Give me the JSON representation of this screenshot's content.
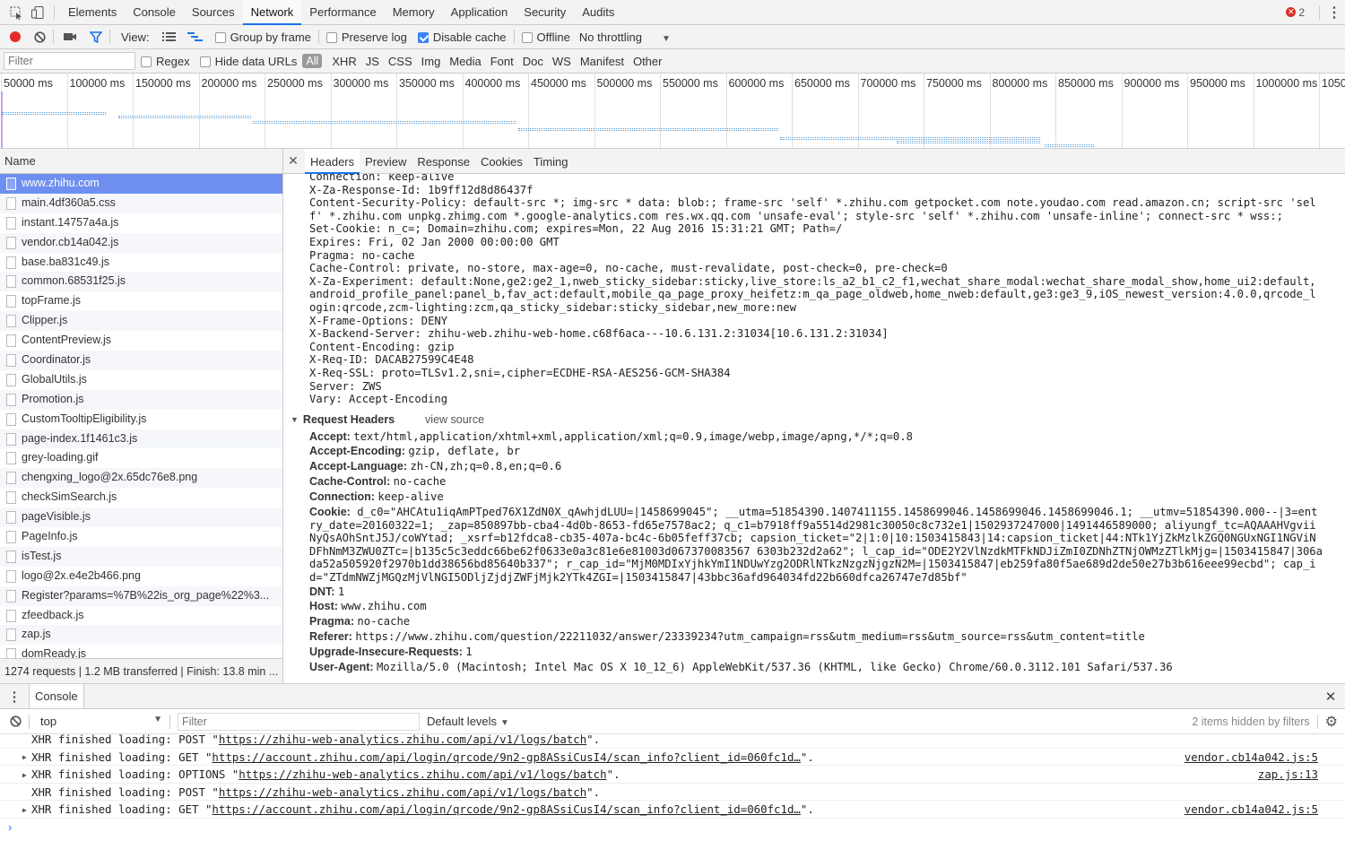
{
  "devtools": {
    "tabs": [
      "Elements",
      "Console",
      "Sources",
      "Network",
      "Performance",
      "Memory",
      "Application",
      "Security",
      "Audits"
    ],
    "active_tab": "Network",
    "error_count": "2"
  },
  "toolbar": {
    "view_label": "View:",
    "group_by_frame": "Group by frame",
    "preserve_log": "Preserve log",
    "disable_cache": "Disable cache",
    "offline": "Offline",
    "throttling": "No throttling"
  },
  "filterbar": {
    "placeholder": "Filter",
    "regex": "Regex",
    "hide_data_urls": "Hide data URLs",
    "types": [
      "All",
      "XHR",
      "JS",
      "CSS",
      "Img",
      "Media",
      "Font",
      "Doc",
      "WS",
      "Manifest",
      "Other"
    ]
  },
  "timeline": {
    "ticks": [
      "50000 ms",
      "100000 ms",
      "150000 ms",
      "200000 ms",
      "250000 ms",
      "300000 ms",
      "350000 ms",
      "400000 ms",
      "450000 ms",
      "500000 ms",
      "550000 ms",
      "600000 ms",
      "650000 ms",
      "700000 ms",
      "750000 ms",
      "800000 ms",
      "850000 ms",
      "900000 ms",
      "950000 ms",
      "1000000 ms",
      "1050"
    ]
  },
  "requests": {
    "column_name": "Name",
    "items": [
      "www.zhihu.com",
      "main.4df360a5.css",
      "instant.14757a4a.js",
      "vendor.cb14a042.js",
      "base.ba831c49.js",
      "common.68531f25.js",
      "topFrame.js",
      "Clipper.js",
      "ContentPreview.js",
      "Coordinator.js",
      "GlobalUtils.js",
      "Promotion.js",
      "CustomTooltipEligibility.js",
      "page-index.1f1461c3.js",
      "grey-loading.gif",
      "chengxing_logo@2x.65dc76e8.png",
      "checkSimSearch.js",
      "pageVisible.js",
      "PageInfo.js",
      "isTest.js",
      "logo@2x.e4e2b466.png",
      "Register?params=%7B%22is_org_page%22%3...",
      "zfeedback.js",
      "zap.js",
      "domReady.js"
    ],
    "summary": "1274 requests | 1.2 MB transferred | Finish: 13.8 min ..."
  },
  "detail": {
    "tabs": [
      "Headers",
      "Preview",
      "Response",
      "Cookies",
      "Timing"
    ],
    "active_tab": "Headers",
    "response_headers": [
      "Connection: keep-alive",
      "X-Za-Response-Id: 1b9ff12d8d86437f",
      "Content-Security-Policy: default-src *; img-src * data: blob:; frame-src 'self' *.zhihu.com getpocket.com note.youdao.com read.amazon.cn; script-src 'sel",
      "f' *.zhihu.com unpkg.zhimg.com *.google-analytics.com res.wx.qq.com 'unsafe-eval'; style-src 'self' *.zhihu.com 'unsafe-inline'; connect-src * wss:;",
      "Set-Cookie: n_c=; Domain=zhihu.com; expires=Mon, 22 Aug 2016 15:31:21 GMT; Path=/",
      "Expires: Fri, 02 Jan 2000 00:00:00 GMT",
      "Pragma: no-cache",
      "Cache-Control: private, no-store, max-age=0, no-cache, must-revalidate, post-check=0, pre-check=0",
      "X-Za-Experiment: default:None,ge2:ge2_1,nweb_sticky_sidebar:sticky,live_store:ls_a2_b1_c2_f1,wechat_share_modal:wechat_share_modal_show,home_ui2:default,",
      "android_profile_panel:panel_b,fav_act:default,mobile_qa_page_proxy_heifetz:m_qa_page_oldweb,home_nweb:default,ge3:ge3_9,iOS_newest_version:4.0.0,qrcode_l",
      "ogin:qrcode,zcm-lighting:zcm,qa_sticky_sidebar:sticky_sidebar,new_more:new",
      "X-Frame-Options: DENY",
      "X-Backend-Server: zhihu-web.zhihu-web-home.c68f6aca---10.6.131.2:31034[10.6.131.2:31034]",
      "Content-Encoding: gzip",
      "X-Req-ID: DACAB27599C4E48",
      "X-Req-SSL: proto=TLSv1.2,sni=,cipher=ECDHE-RSA-AES256-GCM-SHA384",
      "Server: ZWS",
      "Vary: Accept-Encoding"
    ],
    "request_headers_title": "Request Headers",
    "view_source": "view source",
    "request_headers": [
      {
        "k": "Accept:",
        "v": "text/html,application/xhtml+xml,application/xml;q=0.9,image/webp,image/apng,*/*;q=0.8"
      },
      {
        "k": "Accept-Encoding:",
        "v": "gzip, deflate, br"
      },
      {
        "k": "Accept-Language:",
        "v": "zh-CN,zh;q=0.8,en;q=0.6"
      },
      {
        "k": "Cache-Control:",
        "v": "no-cache"
      },
      {
        "k": "Connection:",
        "v": "keep-alive"
      }
    ],
    "cookie_key": "Cookie:",
    "cookie_lines": [
      "d_c0=\"AHCAtu1iqAmPTped76X1ZdN0X_qAwhjdLUU=|1458699045\"; __utma=51854390.1407411155.1458699046.1458699046.1458699046.1; __utmv=51854390.000--|3=ent",
      "ry_date=20160322=1; _zap=850897bb-cba4-4d0b-8653-fd65e7578ac2; q_c1=b7918ff9a5514d2981c30050c8c732e1|1502937247000|1491446589000; aliyungf_tc=AQAAAHVgvii",
      "NyQsAOhSntJ5J/coWYtad; _xsrf=b12fdca8-cb35-407a-bc4c-6b05feff37cb; capsion_ticket=\"2|1:0|10:1503415843|14:capsion_ticket|44:NTk1YjZkMzlkZGQ0NGUxNGI1NGViN",
      "DFhNmM3ZWU0ZTc=|b135c5c3eddc66be62f0633e0a3c81e6e81003d067370083567 6303b232d2a62\"; l_cap_id=\"ODE2Y2VlNzdkMTFkNDJiZmI0ZDNhZTNjOWMzZTlkMjg=|1503415847|306a",
      "da52a505920f2970b1dd38656bd85640b337\"; r_cap_id=\"MjM0MDIxYjhkYmI1NDUwYzg2ODRlNTkzNzgzNjgzN2M=|1503415847|eb259fa80f5ae689d2de50e27b3b616eee99ecbd\"; cap_i",
      "d=\"ZTdmNWZjMGQzMjVlNGI5ODljZjdjZWFjMjk2YTk4ZGI=|1503415847|43bbc36afd964034fd22b660dfca26747e7d85bf\""
    ],
    "request_headers_tail": [
      {
        "k": "DNT:",
        "v": "1"
      },
      {
        "k": "Host:",
        "v": "www.zhihu.com"
      },
      {
        "k": "Pragma:",
        "v": "no-cache"
      },
      {
        "k": "Referer:",
        "v": "https://www.zhihu.com/question/22211032/answer/23339234?utm_campaign=rss&utm_medium=rss&utm_source=rss&utm_content=title"
      },
      {
        "k": "Upgrade-Insecure-Requests:",
        "v": "1"
      },
      {
        "k": "User-Agent:",
        "v": "Mozilla/5.0 (Macintosh; Intel Mac OS X 10_12_6) AppleWebKit/537.36 (KHTML, like Gecko) Chrome/60.0.3112.101 Safari/537.36"
      }
    ]
  },
  "console": {
    "tab": "Console",
    "context": "top",
    "filter_placeholder": "Filter",
    "levels": "Default levels",
    "hidden": "2 items hidden by filters",
    "messages": [
      {
        "prefix": "XHR finished loading: POST \"",
        "url": "https://zhihu-web-analytics.zhihu.com/api/v1/logs/batch",
        "suffix": "\".",
        "src": ""
      },
      {
        "prefix": "XHR finished loading: GET \"",
        "url": "https://account.zhihu.com/api/login/qrcode/9n2-gp8ASsiCusI4/scan_info?client_id=060fc1d…",
        "suffix": "\".",
        "src": "vendor.cb14a042.js:5"
      },
      {
        "prefix": "XHR finished loading: OPTIONS \"",
        "url": "https://zhihu-web-analytics.zhihu.com/api/v1/logs/batch",
        "suffix": "\".",
        "src": "zap.js:13"
      },
      {
        "prefix": "XHR finished loading: POST \"",
        "url": "https://zhihu-web-analytics.zhihu.com/api/v1/logs/batch",
        "suffix": "\".",
        "src": ""
      },
      {
        "prefix": "XHR finished loading: GET \"",
        "url": "https://account.zhihu.com/api/login/qrcode/9n2-gp8ASsiCusI4/scan_info?client_id=060fc1d…",
        "suffix": "\".",
        "src": "vendor.cb14a042.js:5"
      }
    ]
  },
  "colors": {
    "accent": "#1a73e8",
    "selected_row": "#6e8ff0",
    "record": "#e52b2b",
    "error": "#d93025"
  }
}
